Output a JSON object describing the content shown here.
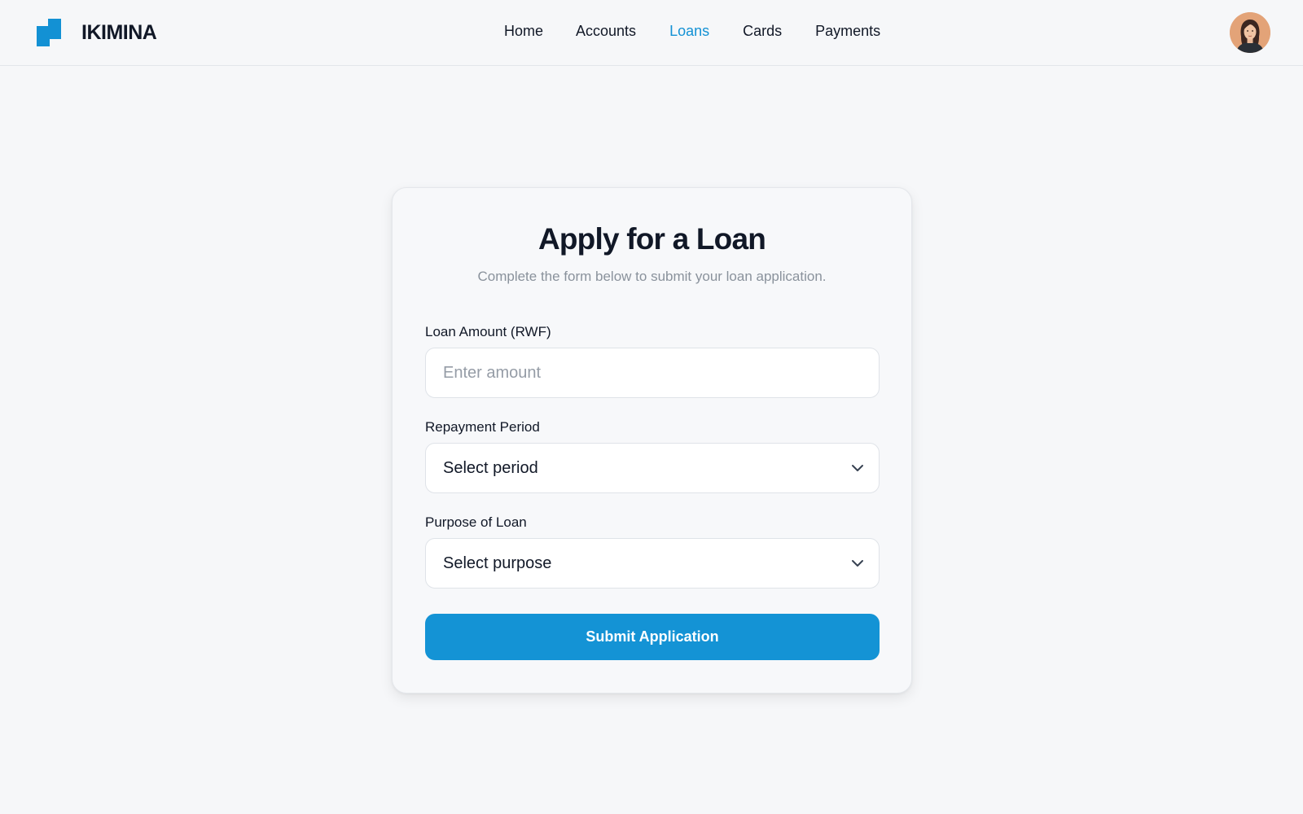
{
  "brand": {
    "name": "IKIMINA",
    "accent": "#1391d4"
  },
  "nav": {
    "items": [
      {
        "label": "Home",
        "active": false
      },
      {
        "label": "Accounts",
        "active": false
      },
      {
        "label": "Loans",
        "active": true
      },
      {
        "label": "Cards",
        "active": false
      },
      {
        "label": "Payments",
        "active": false
      }
    ]
  },
  "user": {
    "avatar_icon": "user-avatar-icon"
  },
  "form": {
    "title": "Apply for a Loan",
    "subtitle": "Complete the form below to submit your loan application.",
    "amount": {
      "label": "Loan Amount (RWF)",
      "placeholder": "Enter amount",
      "value": ""
    },
    "period": {
      "label": "Repayment Period",
      "value": "Select period",
      "icon": "chevron-down-icon"
    },
    "purpose": {
      "label": "Purpose of Loan",
      "value": "Select purpose",
      "icon": "chevron-down-icon"
    },
    "submit_label": "Submit Application",
    "button_color": "#1493d5"
  }
}
